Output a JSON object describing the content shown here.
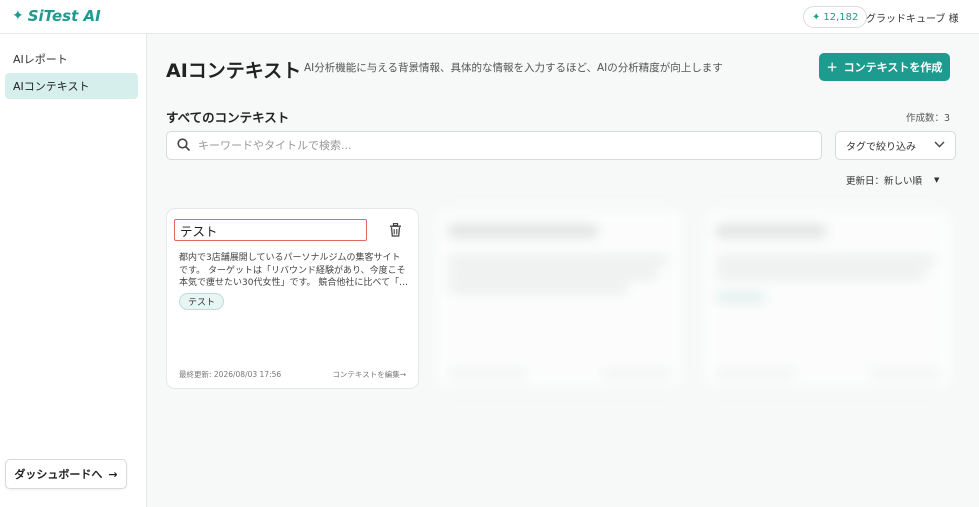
{
  "header": {
    "logo": "SiTest AI",
    "credits": "12,182",
    "user": "グラッドキューブ 様"
  },
  "sidebar": {
    "items": [
      {
        "label": "AIレポート"
      },
      {
        "label": "AIコンテキスト"
      }
    ],
    "dashboard_button": "ダッシュボードへ"
  },
  "main": {
    "title": "AIコンテキスト",
    "description": "AI分析機能に与える背景情報、具体的な情報を入力するほど、AIの分析精度が向上します",
    "create_button": "コンテキストを作成",
    "section_title": "すべてのコンテキスト",
    "count": "作成数：3",
    "search_placeholder": "キーワードやタイトルで検索...",
    "tag_filter": "タグで絞り込み",
    "sort": "更新日：新しい順"
  },
  "cards": [
    {
      "title": "テスト",
      "description": "都内で3店舗展開しているパーソナルジムの集客サイトです。 ターゲットは「リバウンド経験があり、今度こそ本気で痩せたい30代女性」です。 競合他社に比べて「…",
      "tag": "テスト",
      "updated": "最終更新: 2026/08/03 17:56",
      "edit": "コンテキストを編集→"
    }
  ],
  "colors": {
    "accent": "#1d9b8e",
    "highlight": "#e06a5e"
  }
}
